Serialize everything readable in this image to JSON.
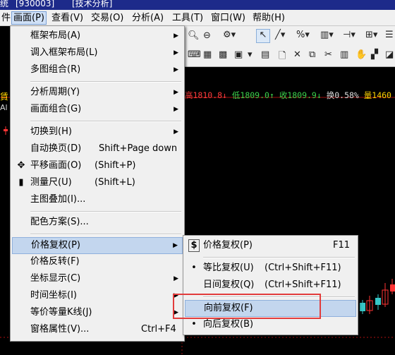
{
  "titlebar": {
    "left": "统",
    "code": "[930003]",
    "section": "[技术分析]"
  },
  "menubar": {
    "first": "件",
    "items": [
      {
        "label": "画面(P)",
        "active": true
      },
      {
        "label": "查看(V)",
        "active": false
      },
      {
        "label": "交易(O)",
        "active": false
      },
      {
        "label": "分析(A)",
        "active": false
      },
      {
        "label": "工具(T)",
        "active": false
      },
      {
        "label": "窗口(W)",
        "active": false
      },
      {
        "label": "帮助(H)",
        "active": false
      }
    ]
  },
  "quote_line": {
    "high": "高1810.8↓",
    "low": "低1809.0↑",
    "close": "收1809.9↓",
    "turnover": "换0.58%",
    "volume": "量1460"
  },
  "chart_left_chars": {
    "a": "賃",
    "b": "Al"
  },
  "main_menu": {
    "items": [
      {
        "label": "框架布局(A)",
        "submenu": true
      },
      {
        "label": "调入框架布局(L)",
        "submenu": true
      },
      {
        "label": "多图组合(R)",
        "submenu": true
      },
      {
        "label": "分析周期(Y)",
        "submenu": true
      },
      {
        "label": "画面组合(G)",
        "submenu": true
      },
      {
        "label": "切换到(H)",
        "submenu": true
      },
      {
        "label": "自动换页(D)",
        "accel": "Shift+Page down"
      },
      {
        "label": "平移画面(O)",
        "accel": "(Shift+P)",
        "icon": "move"
      },
      {
        "label": "测量尺(U)",
        "accel": "(Shift+L)",
        "icon": "ruler"
      },
      {
        "label": "主图叠加(I)..."
      },
      {
        "label": "配色方案(S)..."
      },
      {
        "label": "价格复权(P)",
        "submenu": true,
        "highlighted": true
      },
      {
        "label": "价格反转(F)"
      },
      {
        "label": "坐标显示(C)",
        "submenu": true
      },
      {
        "label": "时间坐标(I)",
        "submenu": true
      },
      {
        "label": "等价等量K线(J)",
        "submenu": true
      },
      {
        "label": "窗格属性(V)...",
        "accel": "Ctrl+F4"
      }
    ]
  },
  "sub_menu": {
    "items": [
      {
        "label": "价格复权(P)",
        "accel": "F11",
        "icon": "$"
      },
      {
        "label": "等比复权(U)",
        "accel": "(Ctrl+Shift+F11)",
        "icon": "bullet"
      },
      {
        "label": "日间复权(Q)",
        "accel": "(Ctrl+Shift+F11)"
      },
      {
        "label": "向前复权(F)",
        "highlighted": true
      },
      {
        "label": "向后复权(B)",
        "icon": "bullet"
      }
    ]
  }
}
